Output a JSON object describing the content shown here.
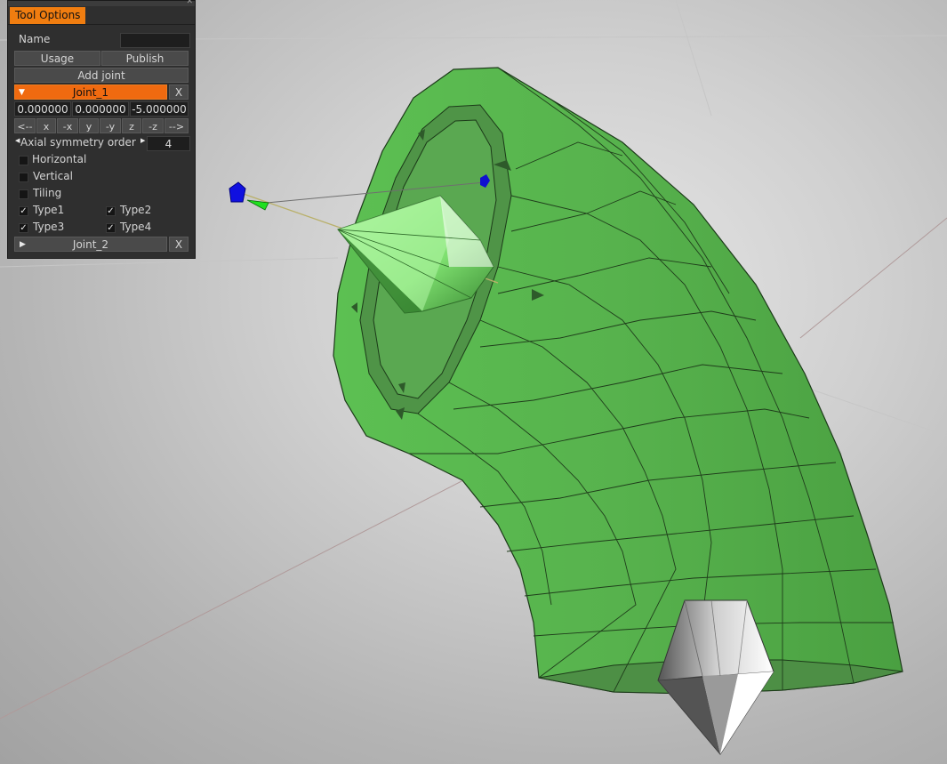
{
  "tool_options": {
    "tab_label": "Tool  Options",
    "name_label": "Name",
    "name_value": "",
    "usage_label": "Usage",
    "publish_label": "Publish",
    "add_joint_label": "Add  joint",
    "joint1": {
      "label": "Joint_1",
      "close_label": "X",
      "x": "0.000000",
      "y": "0.000000",
      "z": "-5.000000"
    },
    "axis_buttons": [
      "<--",
      "x",
      "-x",
      "y",
      "-y",
      "z",
      "-z",
      "-->"
    ],
    "axial_label": "Axial  symmetry  order",
    "axial_value": "4",
    "horizontal_label": "Horizontal",
    "horizontal_checked": false,
    "vertical_label": "Vertical",
    "vertical_checked": false,
    "tiling_label": "Tiling",
    "tiling_checked": false,
    "type1_label": "Type1",
    "type2_label": "Type2",
    "type3_label": "Type3",
    "type4_label": "Type4",
    "types_checked": [
      true,
      true,
      true,
      true
    ],
    "joint2": {
      "label": "Joint_2",
      "close_label": "X"
    }
  },
  "viewport": {
    "mesh_color": "#5fc454",
    "mesh_dark": "#3e9a36",
    "joint_cone_color": "#8af27a",
    "bottom_cone_color": "#f2f2f2",
    "gizmo_blue": "#1010e0",
    "gizmo_green": "#20e020"
  }
}
